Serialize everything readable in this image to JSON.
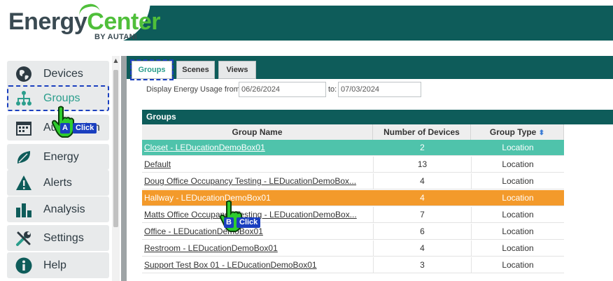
{
  "header": {
    "logo_energy": "Energy",
    "logo_center": "Center",
    "logo_byline": "BY AUTANI"
  },
  "sidebar": {
    "items": [
      {
        "label": "Devices",
        "icon": "globe-icon"
      },
      {
        "label": "Groups",
        "icon": "hierarchy-icon",
        "active": true
      },
      {
        "label": "Automation",
        "icon": "calendar-icon"
      },
      {
        "label": "Energy",
        "icon": "leaf-icon"
      },
      {
        "label": "Alerts",
        "icon": "warning-icon"
      },
      {
        "label": "Analysis",
        "icon": "bar-chart-icon"
      },
      {
        "label": "Settings",
        "icon": "tools-icon"
      },
      {
        "label": "Help",
        "icon": "info-icon"
      }
    ]
  },
  "tabs": [
    {
      "label": "Groups",
      "active": true
    },
    {
      "label": "Scenes"
    },
    {
      "label": "Views"
    }
  ],
  "filter": {
    "from_label": "Display Energy Usage from:",
    "from_value": "06/26/2024",
    "to_label": "to:",
    "to_value": "07/03/2024"
  },
  "grid": {
    "title": "Groups",
    "columns": [
      "Group Name",
      "Number of Devices",
      "Group Type"
    ],
    "sort_glyph": "⬍",
    "rows": [
      {
        "name": "Closet - LEDucationDemoBox01",
        "devices": "2",
        "type": "Location",
        "highlight": "selected"
      },
      {
        "name": "Default",
        "devices": "13",
        "type": "Location"
      },
      {
        "name": "Doug Office Occupancy Testing - LEDucationDemoBox...",
        "devices": "4",
        "type": "Location"
      },
      {
        "name": "Hallway - LEDucationDemoBox01",
        "devices": "4",
        "type": "Location",
        "highlight": "hover"
      },
      {
        "name": "Matts Office Occupancy Testing - LEDucationDemoBox...",
        "devices": "7",
        "type": "Location"
      },
      {
        "name": "Office - LEDucationDemoBox01",
        "devices": "6",
        "type": "Location"
      },
      {
        "name": "Restroom - LEDucationDemoBox01",
        "devices": "4",
        "type": "Location"
      },
      {
        "name": "Support Test Box 01 - LEDucationDemoBox01",
        "devices": "3",
        "type": "Location"
      }
    ]
  },
  "annotations": {
    "a_letter": "A",
    "b_letter": "B",
    "click_label": "Click"
  },
  "colors": {
    "brand_teal": "#0e5c5a",
    "selected_row": "#4fc3ab",
    "hover_row": "#f39a2b",
    "annotation_blue": "#1a3fbf",
    "hand_green": "#2ecc2e"
  }
}
